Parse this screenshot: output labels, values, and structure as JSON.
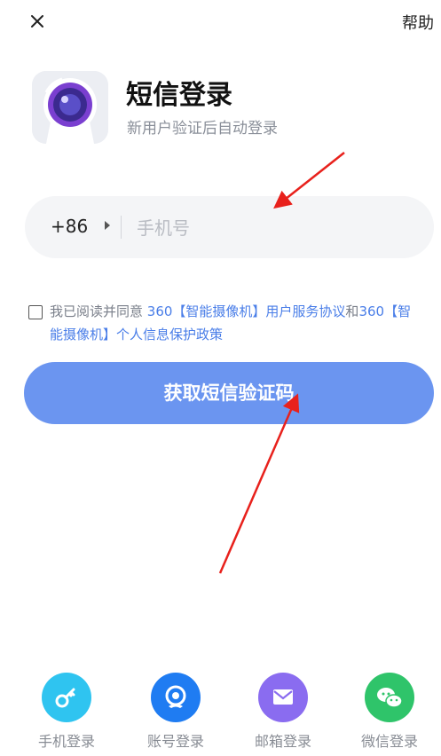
{
  "topbar": {
    "help_label": "帮助"
  },
  "header": {
    "title": "短信登录",
    "subtitle": "新用户验证后自动登录"
  },
  "phone": {
    "country_code": "+86",
    "placeholder": "手机号",
    "value": ""
  },
  "agreement": {
    "prefix": "我已阅读并同意",
    "link1": " 360【智能摄像机】用户服务协议",
    "conj": "和",
    "link2": "360【智能摄像机】个人信息保护政策",
    "checked": false
  },
  "sms_button_label": "获取短信验证码",
  "login_options": [
    {
      "label": "手机登录",
      "icon": "key-icon",
      "color": "#2fc4f0"
    },
    {
      "label": "账号登录",
      "icon": "account-icon",
      "color": "#1f7cf2"
    },
    {
      "label": "邮箱登录",
      "icon": "mail-icon",
      "color": "#8a6cf0"
    },
    {
      "label": "微信登录",
      "icon": "wechat-icon",
      "color": "#2fc46a"
    }
  ],
  "annotation_color": "#e8211c"
}
